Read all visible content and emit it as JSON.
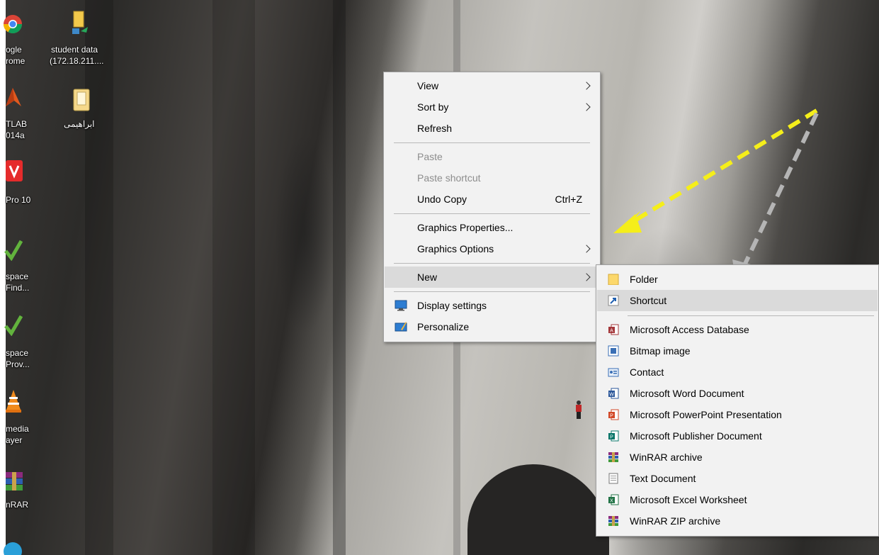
{
  "desktop": {
    "icons": [
      {
        "line1": "ogle",
        "line2": "rome"
      },
      {
        "line1": "student data",
        "line2": "(172.18.211...."
      },
      {
        "line1": "TLAB",
        "line2": "014a"
      },
      {
        "line1": "ابراهيمى",
        "line2": ""
      },
      {
        "line1": "Pro 10",
        "line2": ""
      },
      {
        "line1": "space",
        "line2": "Find..."
      },
      {
        "line1": "space",
        "line2": "Prov..."
      },
      {
        "line1": "media",
        "line2": "ayer"
      },
      {
        "line1": "nRAR",
        "line2": ""
      }
    ]
  },
  "context_menu": {
    "view": "View",
    "sort_by": "Sort by",
    "refresh": "Refresh",
    "paste": "Paste",
    "paste_shortcut": "Paste shortcut",
    "undo_copy": "Undo Copy",
    "undo_shortcut": "Ctrl+Z",
    "graphics_properties": "Graphics Properties...",
    "graphics_options": "Graphics Options",
    "new": "New",
    "display_settings": "Display settings",
    "personalize": "Personalize"
  },
  "new_submenu": {
    "folder": "Folder",
    "shortcut": "Shortcut",
    "access": "Microsoft Access Database",
    "bitmap": "Bitmap image",
    "contact": "Contact",
    "word": "Microsoft Word Document",
    "powerpoint": "Microsoft PowerPoint Presentation",
    "publisher": "Microsoft Publisher Document",
    "winrar": "WinRAR archive",
    "text": "Text Document",
    "excel": "Microsoft Excel Worksheet",
    "winrar_zip": "WinRAR ZIP archive"
  },
  "colors": {
    "menu_bg": "#f2f2f2",
    "highlight": "#dadada",
    "disabled_text": "#8d8d8d",
    "yellow_arrow": "#f5ee1a",
    "grey_arrow": "#b5b5b5"
  }
}
